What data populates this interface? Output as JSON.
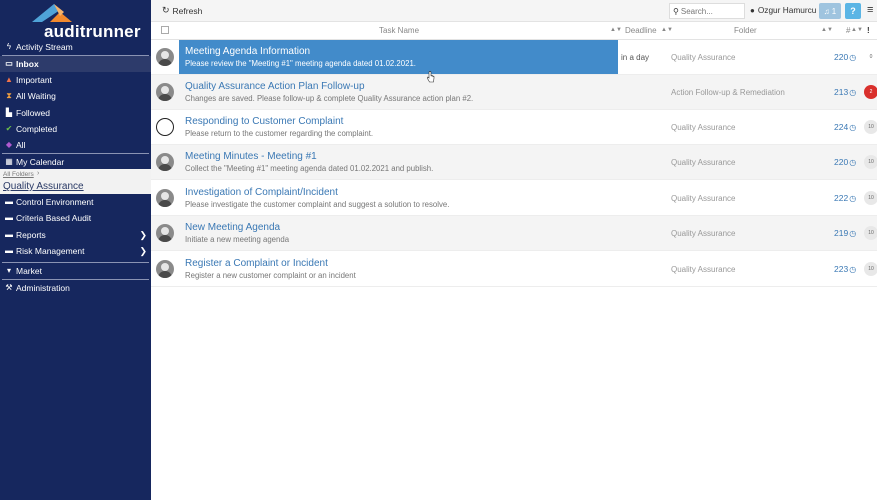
{
  "app": {
    "logo_text": "auditrunner"
  },
  "sidebar": {
    "items": [
      {
        "label": "Activity Stream",
        "icon": "bolt-icon"
      },
      {
        "label": "Inbox",
        "icon": "inbox-icon"
      },
      {
        "label": "Important",
        "icon": "warning-icon"
      },
      {
        "label": "All Waiting",
        "icon": "hourglass-icon"
      },
      {
        "label": "Followed",
        "icon": "followed-icon"
      },
      {
        "label": "Completed",
        "icon": "check-icon"
      },
      {
        "label": "All",
        "icon": "tag-icon"
      },
      {
        "label": "My Calendar",
        "icon": "calendar-icon"
      }
    ],
    "breadcrumb": {
      "root": "All Folders",
      "separator": "›",
      "current": "Quality Assurance"
    },
    "folders": [
      {
        "label": "Control Environment",
        "icon": "folder-icon"
      },
      {
        "label": "Criteria Based Audit",
        "icon": "folder-icon"
      },
      {
        "label": "Reports",
        "icon": "folder-icon"
      },
      {
        "label": "Risk Management",
        "icon": "folder-icon"
      }
    ],
    "bottom": [
      {
        "label": "Market",
        "icon": "cart-icon"
      },
      {
        "label": "Administration",
        "icon": "wrench-icon"
      }
    ]
  },
  "toolbar": {
    "refresh_label": "Refresh",
    "search_placeholder": "Search...",
    "user_name": "Ozgur Hamurcu",
    "notifications": "1",
    "help": "?"
  },
  "table": {
    "headers": {
      "task": "Task Name",
      "deadline": "Deadline",
      "folder": "Folder",
      "num": "#",
      "prio": "!"
    },
    "rows": [
      {
        "title": "Meeting Agenda Information",
        "desc": "Please review the \"Meeting #1\" meeting agenda dated 01.02.2021.",
        "deadline": "in a day",
        "folder": "Quality Assurance",
        "num": "220",
        "prio": "0"
      },
      {
        "title": "Quality Assurance Action Plan Follow-up",
        "desc": "Changes are saved. Please follow-up & complete Quality Assurance action plan #2.",
        "deadline": "",
        "folder": "Action Follow-up & Remediation",
        "num": "213",
        "prio": "2"
      },
      {
        "title": "Responding to Customer Complaint",
        "desc": "Please return to the customer regarding the complaint.",
        "deadline": "",
        "folder": "Quality Assurance",
        "num": "224",
        "prio": "10"
      },
      {
        "title": "Meeting Minutes - Meeting #1",
        "desc": "Collect the \"Meeting #1\" meeting agenda dated 01.02.2021 and publish.",
        "deadline": "",
        "folder": "Quality Assurance",
        "num": "220",
        "prio": "10"
      },
      {
        "title": "Investigation of Complaint/Incident",
        "desc": "Please investigate the customer complaint and suggest a solution to resolve.",
        "deadline": "",
        "folder": "Quality Assurance",
        "num": "222",
        "prio": "10"
      },
      {
        "title": "New Meeting Agenda",
        "desc": "Initiate a new meeting agenda",
        "deadline": "",
        "folder": "Quality Assurance",
        "num": "219",
        "prio": "10"
      },
      {
        "title": "Register a Complaint or Incident",
        "desc": "Register a new customer complaint or an incident",
        "deadline": "",
        "folder": "Quality Assurance",
        "num": "223",
        "prio": "10"
      }
    ]
  },
  "colors": {
    "sidebar": "#16275e",
    "highlight": "#428bca",
    "link": "#3a78b4",
    "alert": "#d9302c"
  }
}
